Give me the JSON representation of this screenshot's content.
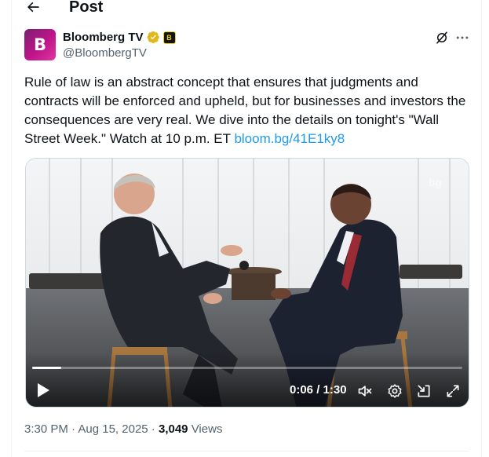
{
  "header": {
    "title": "Post",
    "back_icon": "arrow-left-icon"
  },
  "author": {
    "display_name": "Bloomberg TV",
    "handle": "@BloombergTV",
    "avatar_letter": "B",
    "affiliate_badge_letter": "B",
    "verified_color": "#e2b719",
    "avatar_color": "#c0148a"
  },
  "tweet": {
    "text": "Rule of law is an abstract concept that ensures that judgments and contracts will be enforced and upheld, but for businesses and investors the consequences are very real. We dive into the details on tonight's \"Wall Street Week.\" Watch at 10 p.m. ET ",
    "link": "bloom.bg/41E1ky8",
    "link_color": "#1d9bf0"
  },
  "video": {
    "watermark": "bg",
    "current_time": "0:06",
    "duration": "1:30",
    "time_display": "0:06 / 1:30",
    "progress": 0.067
  },
  "meta": {
    "time": "3:30 PM",
    "separator": " · ",
    "date": "Aug 15, 2025",
    "views_count": "3,049",
    "views_label": " Views"
  }
}
